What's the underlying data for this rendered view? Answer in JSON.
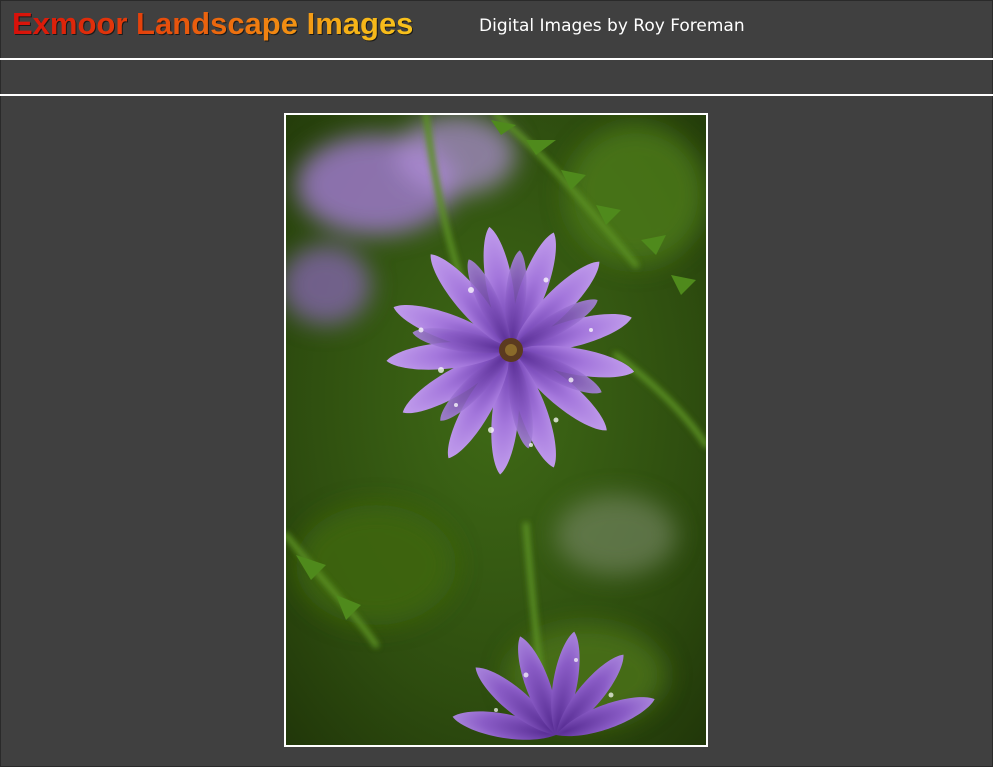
{
  "header": {
    "site_title": "Exmoor Landscape Images",
    "subtitle": "Digital Images by Roy Foreman"
  },
  "colors": {
    "background": "#404040",
    "title_gradient_start": "#d8100a",
    "title_gradient_end": "#f8c21c",
    "rule": "#ffffff",
    "subtitle_text": "#ffffff"
  },
  "photo": {
    "subject": "purple aster flower with dew drops"
  }
}
